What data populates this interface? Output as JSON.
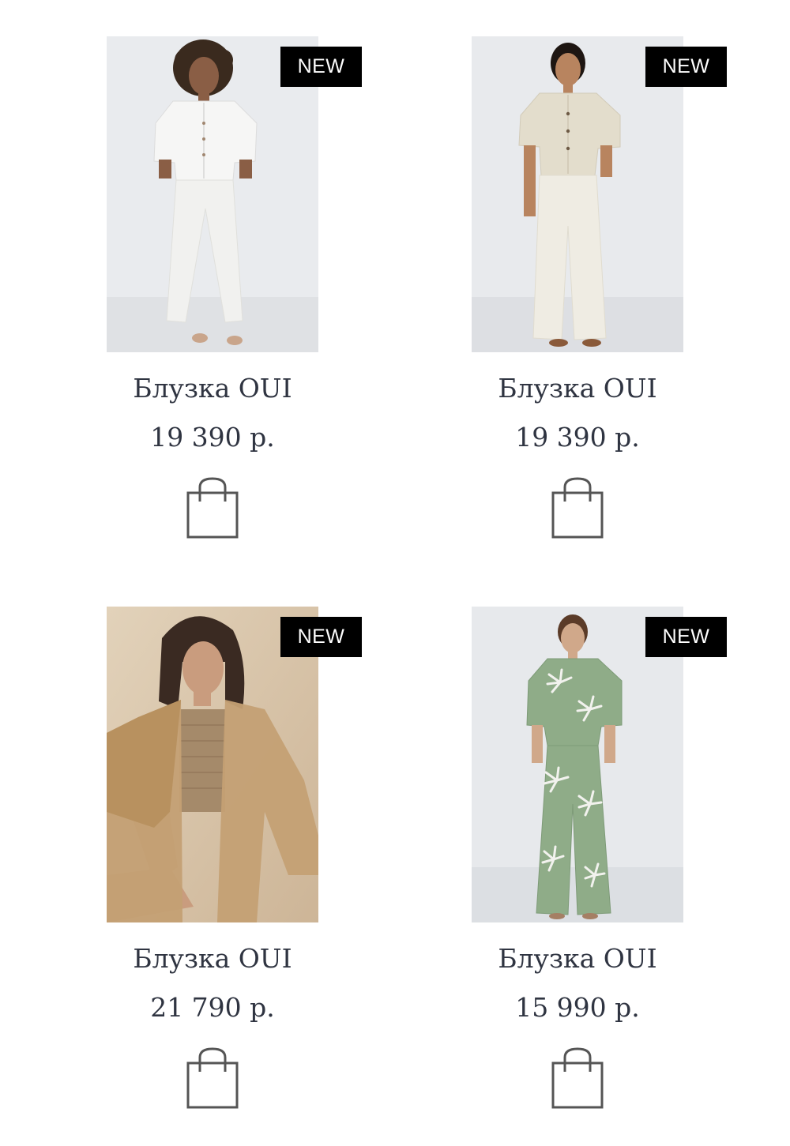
{
  "products": [
    {
      "badge": "NEW",
      "title": "Блузка OUI",
      "price": "19 390 р.",
      "image": "model in white linen cropped shirt and white trousers",
      "colors": {
        "bg": "#e9ebee",
        "top": "#f6f6f5",
        "bottom": "#f1f1ef",
        "skin": "#8a5e45",
        "hair": "#3a2a1e"
      }
    },
    {
      "badge": "NEW",
      "title": "Блузка OUI",
      "price": "19 390 р.",
      "image": "model in beige linen shirt and white wide-leg trousers",
      "colors": {
        "bg": "#e8eaed",
        "top": "#e3ddcc",
        "bottom": "#efece3",
        "skin": "#b8845f",
        "hair": "#1e1612"
      }
    },
    {
      "badge": "NEW",
      "title": "Блузка OUI",
      "price": "21 790 р.",
      "image": "model sitting in camel linen shirt over crochet top",
      "colors": {
        "bg": "#d9c7ad",
        "top": "#c4a074",
        "bottom": "#b89370",
        "skin": "#c99c7e",
        "hair": "#3a2a22"
      }
    },
    {
      "badge": "NEW",
      "title": "Блузка OUI",
      "price": "15 990 р.",
      "image": "model in green palm-print shirt and matching trousers",
      "colors": {
        "bg": "#e7e9ec",
        "top": "#8fac88",
        "bottom": "#8fac88",
        "skin": "#d0a88a",
        "hair": "#5b3b28"
      }
    }
  ],
  "icons": {
    "cart": "shopping-bag-icon"
  }
}
